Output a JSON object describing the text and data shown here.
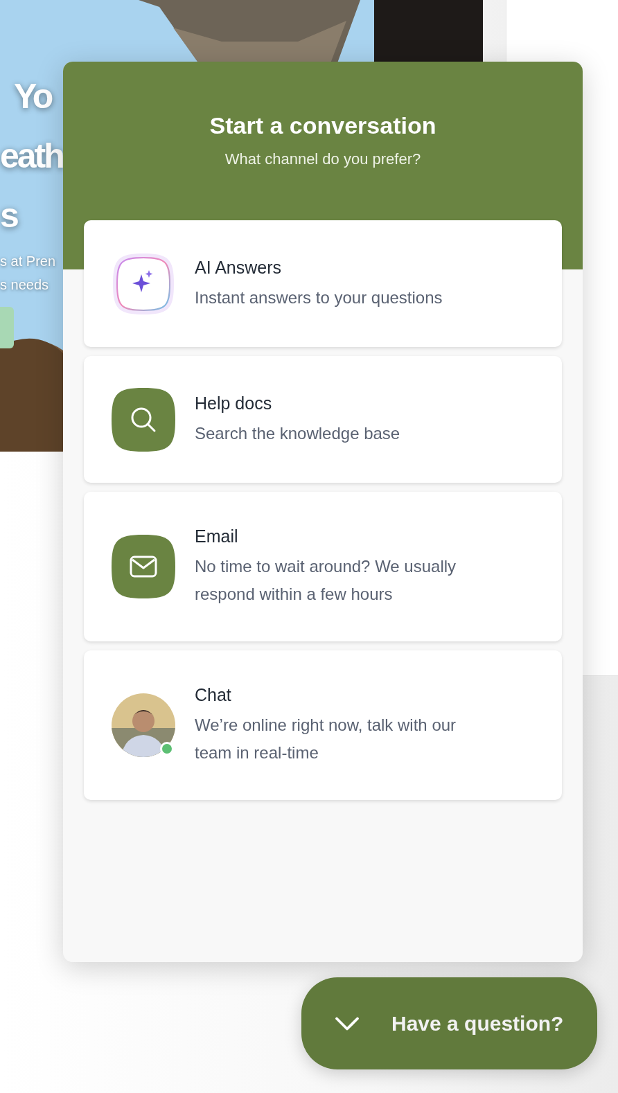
{
  "hero": {
    "headline_lines": [
      "Yo",
      "eath",
      "s"
    ],
    "text_lines": [
      "s at Pren",
      "s needs"
    ]
  },
  "widget": {
    "title": "Start a conversation",
    "subtitle": "What channel do you prefer?",
    "channels": [
      {
        "kind": "ai",
        "title": "AI Answers",
        "description": "Instant answers to your questions"
      },
      {
        "kind": "search",
        "title": "Help docs",
        "description": "Search the knowledge base"
      },
      {
        "kind": "email",
        "title": "Email",
        "description": "No time to wait around? We usually respond within a few hours"
      },
      {
        "kind": "agent",
        "title": "Chat",
        "description": "We’re online right now, talk with our team in real-time",
        "online": true
      }
    ]
  },
  "launcher": {
    "label": "Have a question?",
    "expanded": true
  }
}
